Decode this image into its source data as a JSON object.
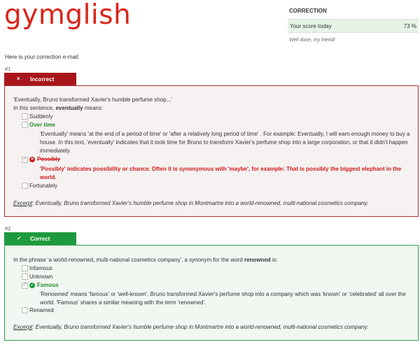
{
  "logo": "gymglish",
  "correction": {
    "title": "CORRECTION",
    "score_label": "Your score today",
    "score_value": "73 %",
    "note": "Well done, my friend!"
  },
  "intro": "Here is your correction e-mail:",
  "q1": {
    "num": "#1",
    "status": "Incorrect",
    "status_mark": "×",
    "quote": "'Eventually, Bruno transformed Xavier's humble perfume shop...'",
    "prompt_pre": "In this sentence, ",
    "prompt_bold": "eventually",
    "prompt_post": " means:",
    "options": [
      "Suddenly",
      "Over time",
      "Possibly",
      "Fortunately"
    ],
    "explain_correct": "'Eventually' means 'at the end of a period of time' or 'after a relatively long period of time' . For example: Eventually, I will earn enough money to buy a house. In this text, 'eventually' indicates that it took time for Bruno to transform Xavier's perfume shop into a large corporation, or that it didn't happen immediately.",
    "explain_wrong": "'Possibly' indicates possibility or chance. Often it is synonymous with 'maybe', for example: That is possibly the biggest elephant in the world.",
    "excerpt_label": "Excerpt",
    "excerpt_text": ": Eventually, Bruno transformed Xavier's humble perfume shop in Montmartre into a world-renowned, multi-national cosmetics company."
  },
  "q2": {
    "num": "#2",
    "status": "Correct",
    "status_mark": "✓",
    "prompt_pre": "In the phrase 'a world-renowned, multi-national cosmetics company', a synonym for the word ",
    "prompt_bold": "renowned",
    "prompt_post": " is:",
    "options": [
      "Infamous",
      "Unknown",
      "Famous",
      "Renamed"
    ],
    "explain": "'Renowned' means 'famous' or 'well-known'. Bruno transformed Xavier's perfume shop into a company which was 'known' or 'celebrated' all over the world. 'Famous' shares a similar meaning with the term 'renowned'.",
    "excerpt_label": "Excerpt",
    "excerpt_text": ": Eventually, Bruno transformed Xavier's humble perfume shop in Montmartre into a world-renowned, multi-national cosmetics company."
  },
  "colors": {
    "brand": "#d9251c",
    "incorrect": "#a8161a",
    "correct": "#1e9a3e"
  }
}
